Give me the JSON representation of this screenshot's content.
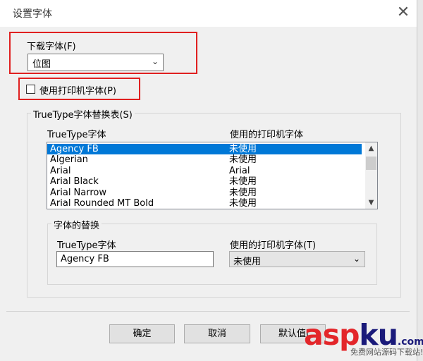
{
  "window": {
    "title": "设置字体",
    "close_glyph": "✕"
  },
  "download_font": {
    "label": "下载字体(F)",
    "value": "位图"
  },
  "use_printer_font": {
    "label": "使用打印机字体(P)",
    "checked": false
  },
  "substitution_table": {
    "title": "TrueType字体替换表(S)",
    "col_truetype": "TrueType字体",
    "col_printer": "使用的打印机字体",
    "rows": [
      {
        "font": "Agency FB",
        "printer": "未使用",
        "selected": true
      },
      {
        "font": "Algerian",
        "printer": "未使用"
      },
      {
        "font": "Arial",
        "printer": "Arial"
      },
      {
        "font": "Arial Black",
        "printer": "未使用"
      },
      {
        "font": "Arial Narrow",
        "printer": "未使用"
      },
      {
        "font": "Arial Rounded MT Bold",
        "printer": "未使用"
      }
    ]
  },
  "font_replace": {
    "title": "字体的替换",
    "truetype_label": "TrueType字体",
    "truetype_value": "Agency FB",
    "printer_label": "使用的打印机字体(T)",
    "printer_value": "未使用"
  },
  "buttons": {
    "ok": "确定",
    "cancel": "取消",
    "defaults": "默认值("
  },
  "watermark": {
    "brand_a": "asp",
    "brand_b": "ku",
    "brand_c": ".com",
    "tagline": "免费网站源码下载站!"
  },
  "colors": {
    "highlight": "#e02020",
    "selection": "#0078d7",
    "watermark_red": "#e3262a",
    "watermark_blue": "#1a1a7a"
  }
}
